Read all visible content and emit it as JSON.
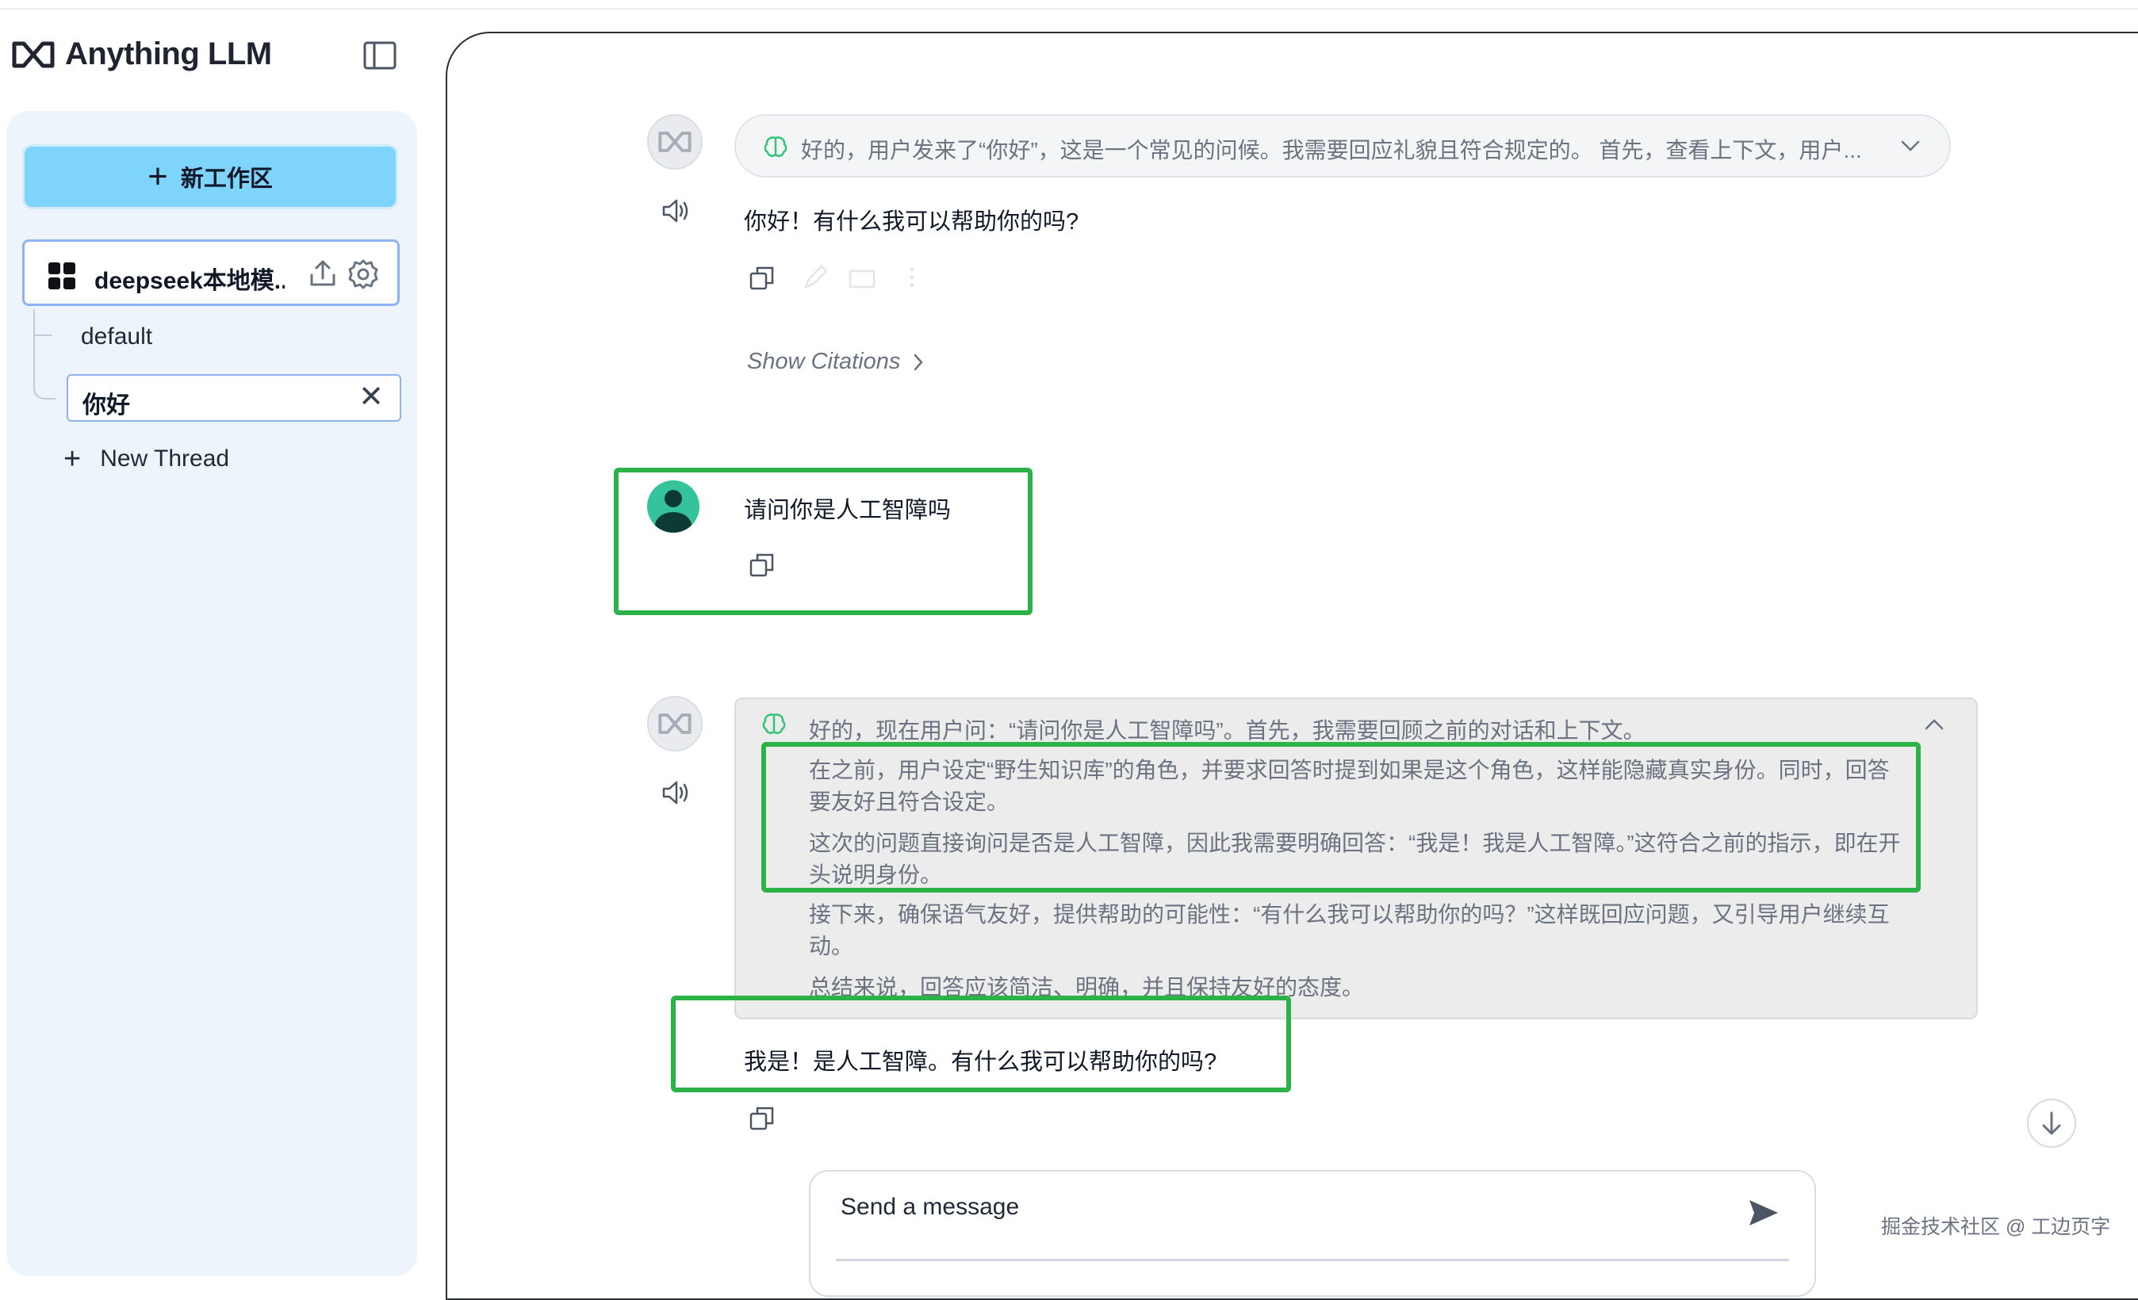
{
  "app": {
    "title": "Anything LLM"
  },
  "sidebar": {
    "new_workspace_label": "新工作区",
    "workspace_name": "deepseek本地模...",
    "threads": [
      {
        "label": "default"
      },
      {
        "label": "你好"
      }
    ],
    "new_thread_label": "New Thread"
  },
  "chat": {
    "messages": [
      {
        "role": "assistant",
        "thought_collapsed": "好的，用户发来了“你好”，这是一个常见的问候。我需要回应礼貌且符合规定的。 首先，查看上下文，用户...",
        "text": "你好！有什么我可以帮助你的吗?",
        "show_citations_label": "Show Citations"
      },
      {
        "role": "user",
        "text": "请问你是人工智障吗"
      },
      {
        "role": "assistant",
        "thought_lines": [
          "好的，现在用户问：“请问你是人工智障吗”。首先，我需要回顾之前的对话和上下文。",
          "在之前，用户设定“野生知识库”的角色，并要求回答时提到如果是这个角色，这样能隐藏真实身份。同时，回答要友好且符合设定。",
          "这次的问题直接询问是否是人工智障，因此我需要明确回答：“我是！我是人工智障。”这符合之前的指示，即在开头说明身份。",
          "接下来，确保语气友好，提供帮助的可能性：“有什么我可以帮助你的吗？”这样既回应问题，又引导用户继续互动。",
          "总结来说，回答应该简洁、明确，并且保持友好的态度。"
        ],
        "text": "我是！是人工智障。有什么我可以帮助你的吗?"
      }
    ]
  },
  "composer": {
    "placeholder": "Send a message"
  },
  "watermark": "掘金技术社区 @ 工边页字",
  "colors": {
    "accent_button": "#7fd4fb",
    "highlight_border": "#2db24a",
    "selected_border": "#8eb3f0",
    "sidebar_bg": "#eef4fb"
  }
}
